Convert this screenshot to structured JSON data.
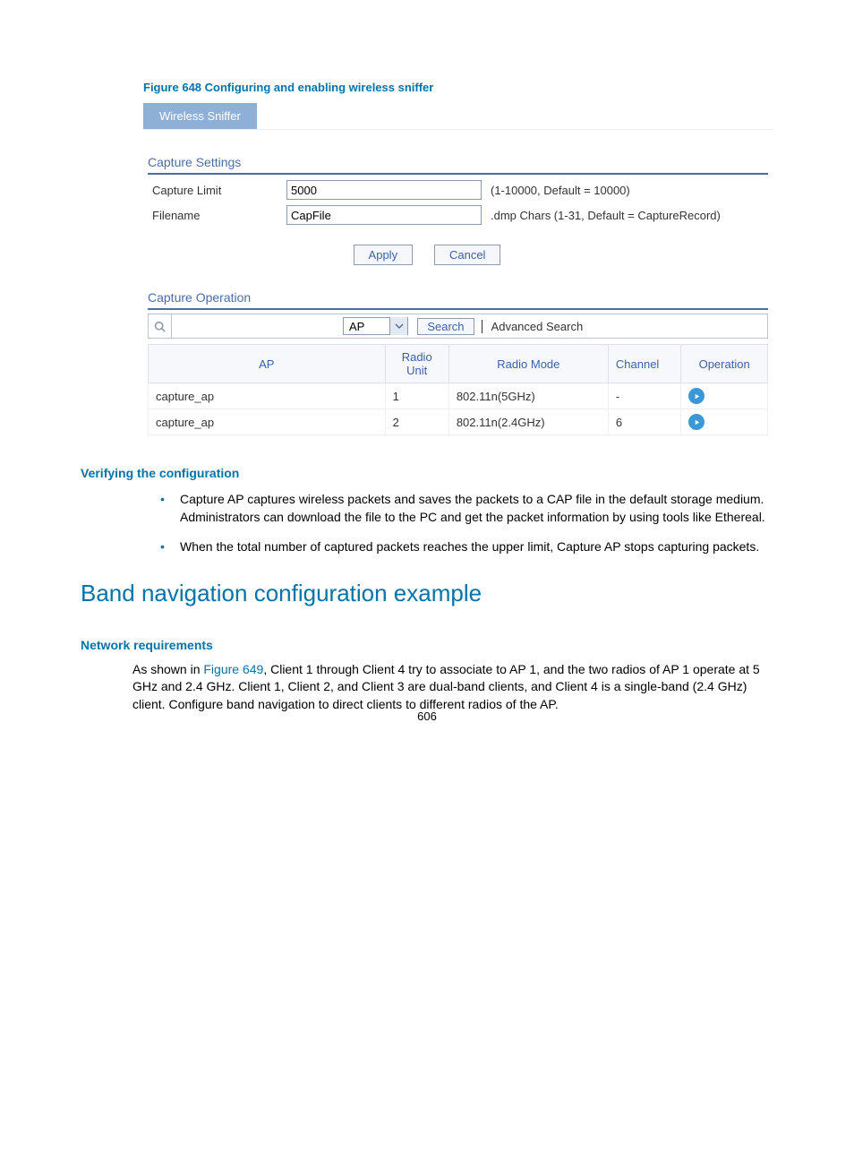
{
  "figure_caption": "Figure 648 Configuring and enabling wireless sniffer",
  "tab_label": "Wireless Sniffer",
  "capture_settings": {
    "title": "Capture Settings",
    "limit_label": "Capture Limit",
    "limit_value": "5000",
    "limit_hint": "(1-10000, Default = 10000)",
    "filename_label": "Filename",
    "filename_value": "CapFile",
    "filename_hint": ".dmp Chars (1-31, Default = CaptureRecord)"
  },
  "buttons": {
    "apply": "Apply",
    "cancel": "Cancel"
  },
  "capture_operation": {
    "title": "Capture Operation",
    "dropdown_value": "AP",
    "search_label": "Search",
    "advanced_label": "Advanced Search",
    "columns": {
      "ap": "AP",
      "radio_unit": "Radio Unit",
      "radio_mode": "Radio Mode",
      "channel": "Channel",
      "operation": "Operation"
    },
    "rows": [
      {
        "ap": "capture_ap",
        "radio_unit": "1",
        "radio_mode": "802.11n(5GHz)",
        "channel": "-"
      },
      {
        "ap": "capture_ap",
        "radio_unit": "2",
        "radio_mode": "802.11n(2.4GHz)",
        "channel": "6"
      }
    ]
  },
  "verifying": {
    "heading": "Verifying the configuration",
    "bullets": [
      "Capture AP captures wireless packets and saves the packets to a CAP file in the default storage medium. Administrators can download the file to the PC and get the packet information by using tools like Ethereal.",
      "When the total number of captured packets reaches the upper limit, Capture AP stops capturing packets."
    ]
  },
  "band_heading": "Band navigation configuration example",
  "network_req": {
    "heading": "Network requirements",
    "pre": "As shown in ",
    "link": "Figure 649",
    "post": ", Client 1 through Client 4 try to associate to AP 1, and the two radios of AP 1 operate at 5 GHz and 2.4 GHz. Client 1, Client 2, and Client 3 are dual-band clients, and Client 4 is a single-band (2.4 GHz) client. Configure band navigation to direct clients to different radios of the AP."
  },
  "page_number": "606"
}
